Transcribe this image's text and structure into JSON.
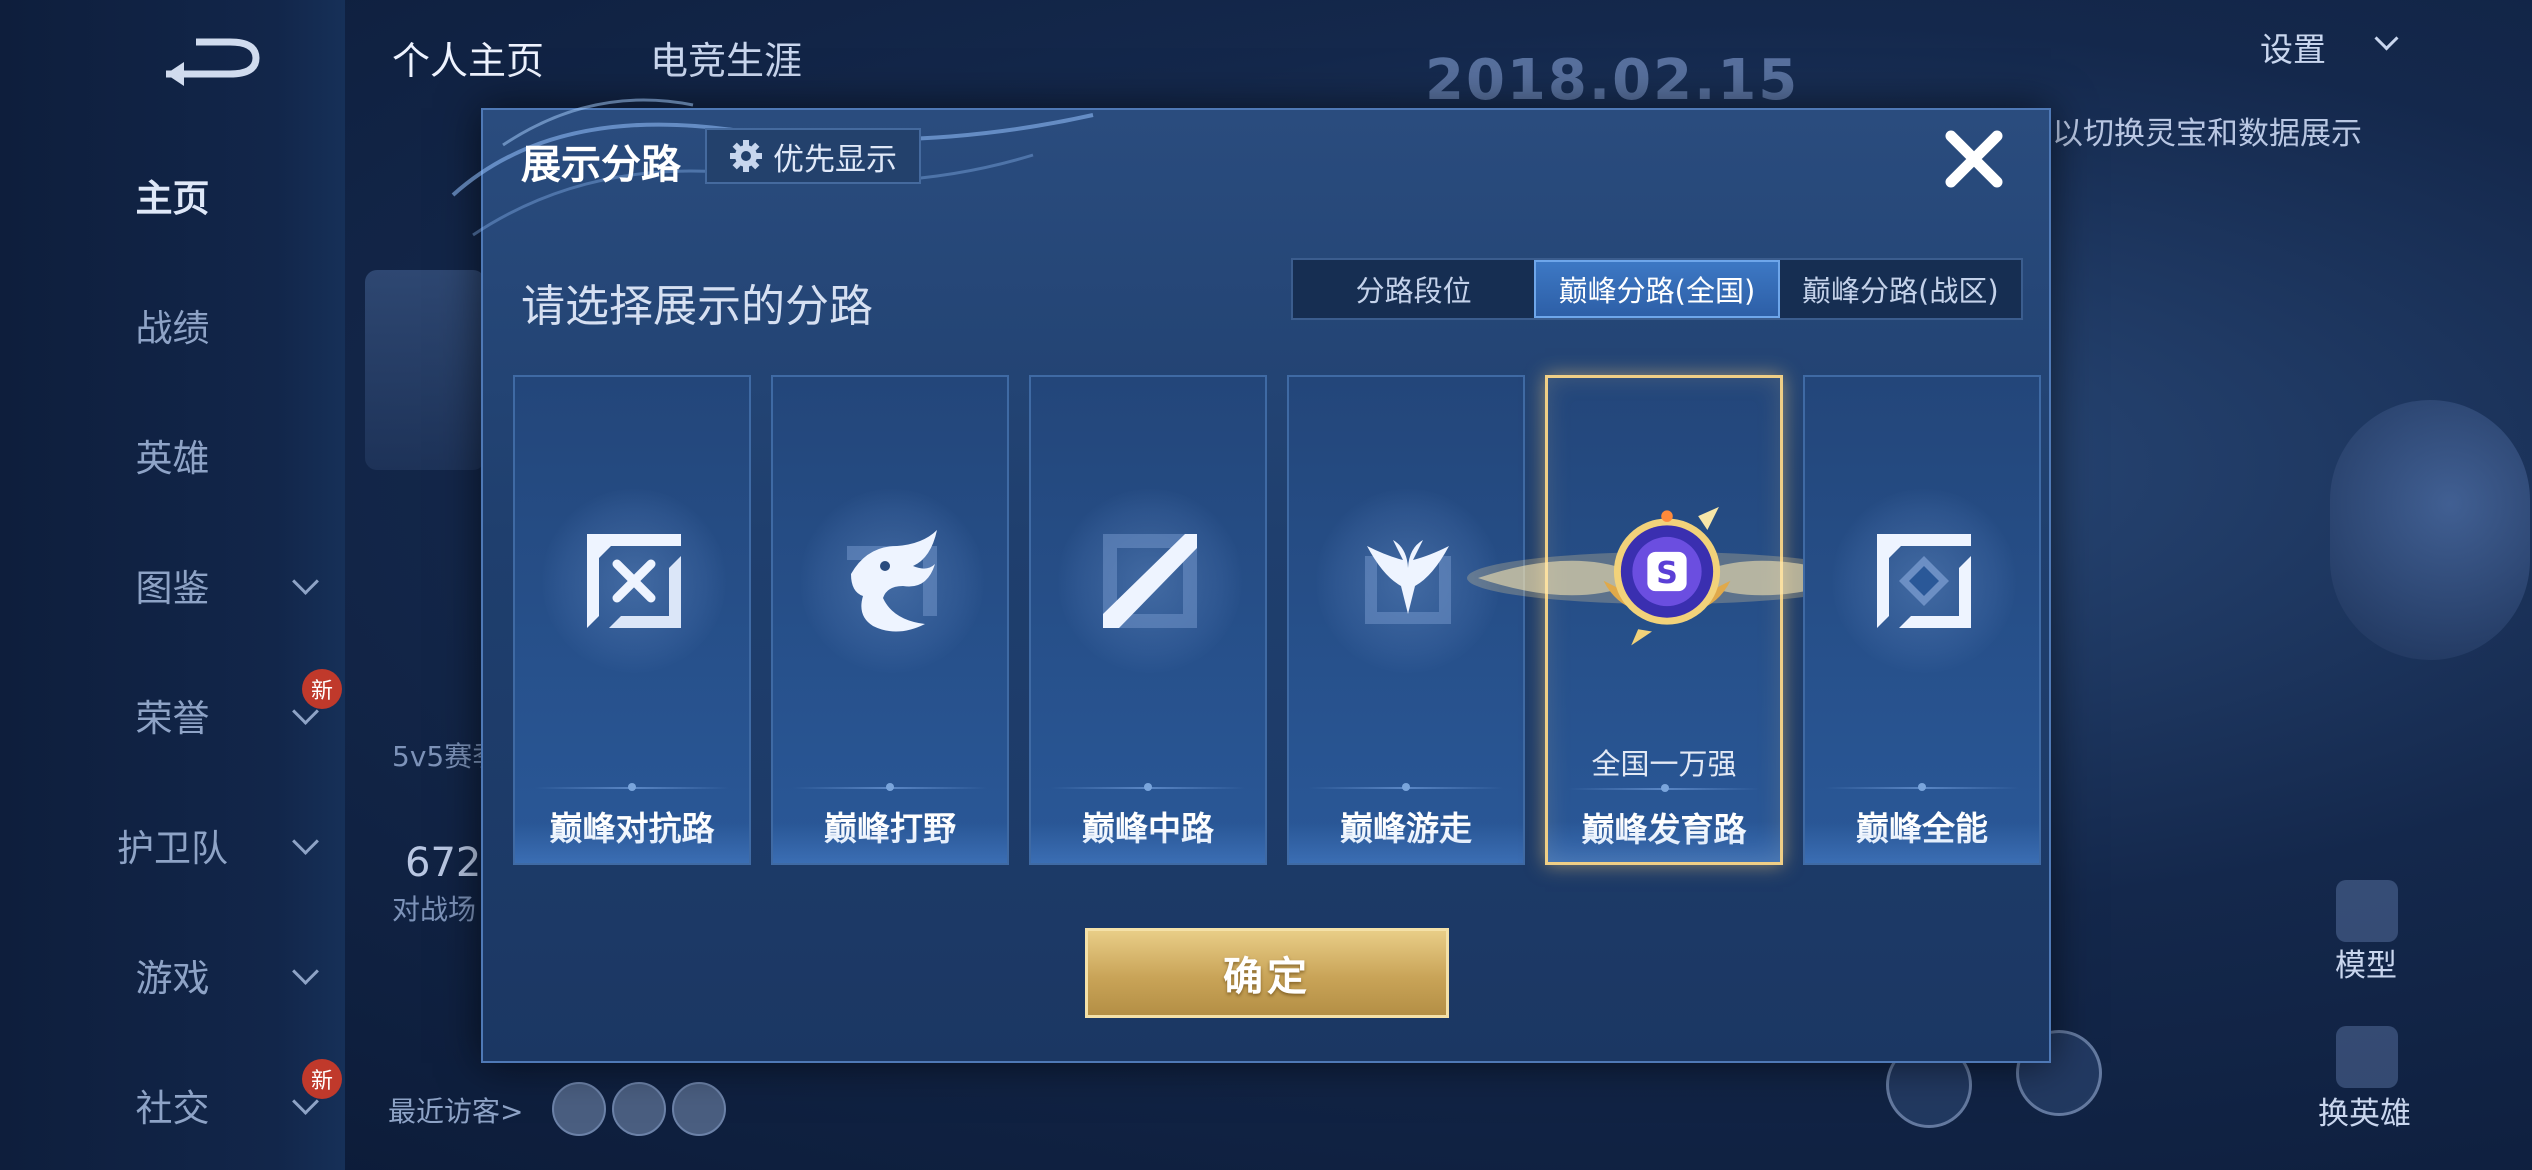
{
  "nav": {
    "items": [
      {
        "label": "主页",
        "active": true,
        "chevron": false,
        "badge": ""
      },
      {
        "label": "战绩",
        "active": false,
        "chevron": false,
        "badge": ""
      },
      {
        "label": "英雄",
        "active": false,
        "chevron": false,
        "badge": ""
      },
      {
        "label": "图鉴",
        "active": false,
        "chevron": true,
        "badge": ""
      },
      {
        "label": "荣誉",
        "active": false,
        "chevron": true,
        "badge": "新"
      },
      {
        "label": "护卫队",
        "active": false,
        "chevron": true,
        "badge": ""
      },
      {
        "label": "游戏",
        "active": false,
        "chevron": true,
        "badge": ""
      },
      {
        "label": "社交",
        "active": false,
        "chevron": true,
        "badge": "新"
      }
    ]
  },
  "header": {
    "tab_profile": "个人主页",
    "tab_career": "电竞生涯",
    "date": "2018.02.15",
    "settings_label": "设置",
    "hint": "以切换灵宝和数据展示"
  },
  "background": {
    "mode_label": "5v5赛季",
    "count": "672",
    "count_label": "对战场",
    "visitors_label": "最近访客>",
    "model_label": "模型",
    "switch_hero_label": "换英雄"
  },
  "modal": {
    "title": "展示分路",
    "priority_label": "优先显示",
    "prompt": "请选择展示的分路",
    "segments": [
      "分路段位",
      "巅峰分路(全国)",
      "巅峰分路(战区)"
    ],
    "active_segment": 1,
    "cards": [
      {
        "label": "巅峰对抗路",
        "icon": "sword-cross-icon",
        "selected": false,
        "rank": ""
      },
      {
        "label": "巅峰打野",
        "icon": "dragon-icon",
        "selected": false,
        "rank": ""
      },
      {
        "label": "巅峰中路",
        "icon": "diagonal-blade-icon",
        "selected": false,
        "rank": ""
      },
      {
        "label": "巅峰游走",
        "icon": "wings-icon",
        "selected": false,
        "rank": ""
      },
      {
        "label": "巅峰发育路",
        "icon": "gold-rank-medal-icon",
        "selected": true,
        "rank": "全国一万强"
      },
      {
        "label": "巅峰全能",
        "icon": "diamond-frame-icon",
        "selected": false,
        "rank": ""
      }
    ],
    "confirm_label": "确定"
  },
  "colors": {
    "accent_gold": "#e8cd87",
    "active_tab": "#3d78c4",
    "modal_bg": "#2a4c7e"
  }
}
